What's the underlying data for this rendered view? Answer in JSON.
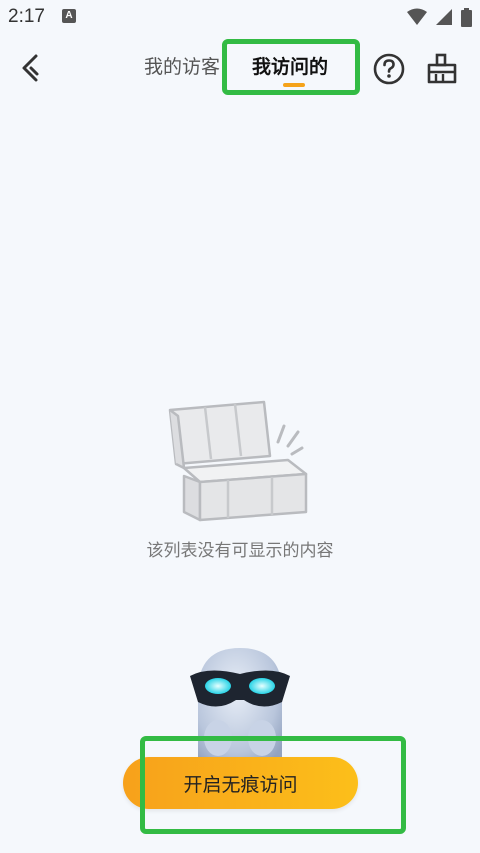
{
  "status_bar": {
    "time": "2:17",
    "notification_letter": "A"
  },
  "header": {
    "tabs": [
      {
        "label": "我的访客"
      },
      {
        "label": "我访问的"
      }
    ],
    "active_tab_index": 1
  },
  "empty_state": {
    "message": "该列表没有可显示的内容"
  },
  "primary_button": {
    "label": "开启无痕访问"
  },
  "colors": {
    "background": "#f5f8fc",
    "accent": "#f5a31a",
    "highlight": "#33bb44"
  },
  "icons": {
    "back": "back-arrow-icon",
    "help": "help-icon",
    "clean": "broom-clean-icon",
    "empty": "empty-box-icon",
    "mascot": "masked-ghost-mascot"
  }
}
